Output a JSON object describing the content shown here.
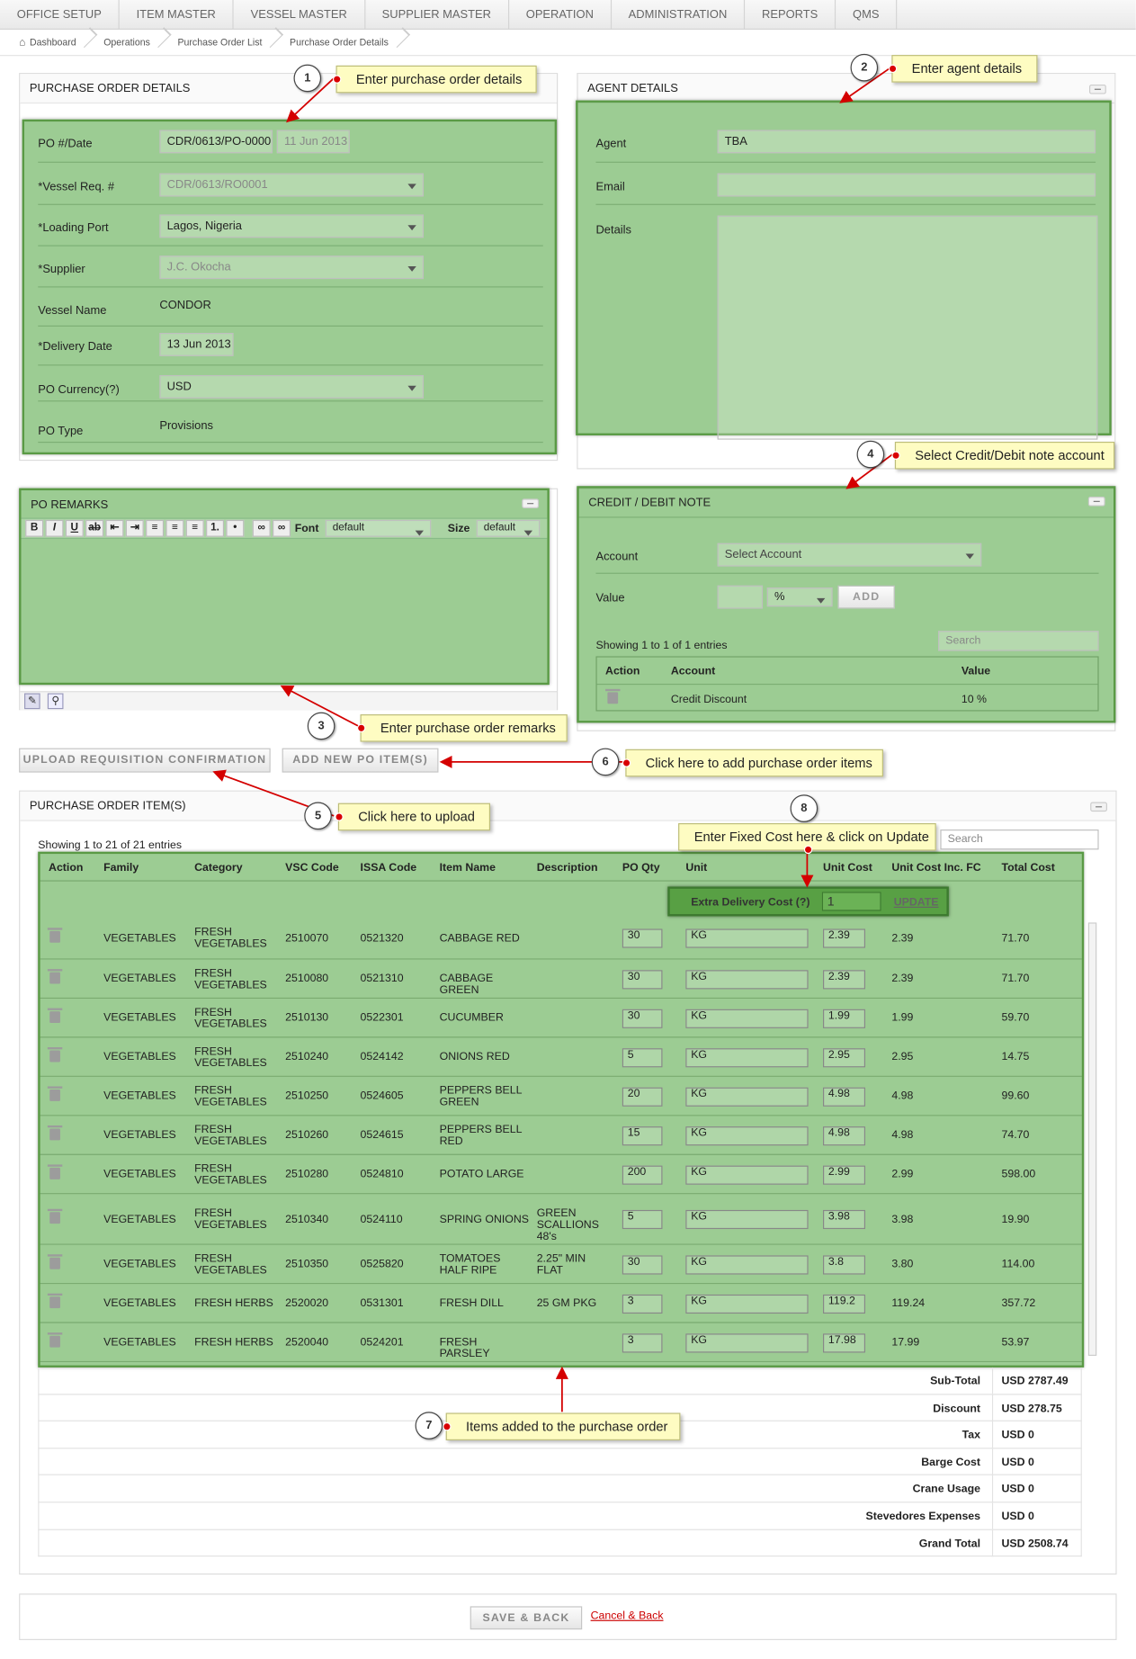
{
  "nav": [
    "OFFICE SETUP",
    "ITEM MASTER",
    "VESSEL MASTER",
    "SUPPLIER MASTER",
    "OPERATION",
    "ADMINISTRATION",
    "REPORTS",
    "QMS"
  ],
  "breadcrumb": [
    "Dashboard",
    "Operations",
    "Purchase Order List",
    "Purchase Order Details"
  ],
  "po": {
    "title": "PURCHASE ORDER DETAILS",
    "po_label": "PO #/Date",
    "po_no": "CDR/0613/PO-0000",
    "po_date": "11 Jun 2013",
    "vessel_req_label": "*Vessel Req. #",
    "vessel_req": "CDR/0613/RO0001",
    "loading_port_label": "*Loading Port",
    "loading_port": "Lagos, Nigeria",
    "supplier_label": "*Supplier",
    "supplier": "J.C. Okocha",
    "vessel_name_label": "Vessel Name",
    "vessel_name": "CONDOR",
    "delivery_label": "*Delivery Date",
    "delivery": "13 Jun 2013",
    "currency_label": "PO Currency(?)",
    "currency": "USD",
    "type_label": "PO Type",
    "type": "Provisions"
  },
  "agent": {
    "title": "AGENT DETAILS",
    "agent_label": "Agent",
    "agent": "TBA",
    "email_label": "Email",
    "details_label": "Details"
  },
  "remarks": {
    "title": "PO REMARKS",
    "font_label": "Font",
    "font_value": "default",
    "size_label": "Size",
    "size_value": "default"
  },
  "credit": {
    "title": "CREDIT / DEBIT NOTE",
    "account_label": "Account",
    "account_placeholder": "Select Account",
    "value_label": "Value",
    "unit": "%",
    "add": "ADD",
    "showing": "Showing 1 to 1 of 1 entries",
    "search": "Search",
    "col_action": "Action",
    "col_account": "Account",
    "col_value": "Value",
    "row_account": "Credit Discount",
    "row_value": "10 %"
  },
  "buttons": {
    "upload": "UPLOAD REQUISITION CONFIRMATION",
    "add_item": "ADD NEW PO ITEM(S)",
    "save": "SAVE & BACK",
    "cancel": "Cancel & Back"
  },
  "items": {
    "title": "PURCHASE ORDER ITEM(S)",
    "showing": "Showing 1 to 21 of 21 entries",
    "search": "Search",
    "headers": [
      "Action",
      "Family",
      "Category",
      "VSC Code",
      "ISSA Code",
      "Item Name",
      "Description",
      "PO Qty",
      "Unit",
      "Unit Cost",
      "Unit Cost Inc. FC",
      "Total Cost"
    ],
    "extra_label": "Extra Delivery Cost (?)",
    "extra_value": "1",
    "update": "UPDATE",
    "rows": [
      [
        "VEGETABLES",
        "FRESH VEGETABLES",
        "2510070",
        "0521320",
        "CABBAGE RED",
        "",
        "30",
        "KG",
        "2.39",
        "2.39",
        "71.70"
      ],
      [
        "VEGETABLES",
        "FRESH VEGETABLES",
        "2510080",
        "0521310",
        "CABBAGE GREEN",
        "",
        "30",
        "KG",
        "2.39",
        "2.39",
        "71.70"
      ],
      [
        "VEGETABLES",
        "FRESH VEGETABLES",
        "2510130",
        "0522301",
        "CUCUMBER",
        "",
        "30",
        "KG",
        "1.99",
        "1.99",
        "59.70"
      ],
      [
        "VEGETABLES",
        "FRESH VEGETABLES",
        "2510240",
        "0524142",
        "ONIONS RED",
        "",
        "5",
        "KG",
        "2.95",
        "2.95",
        "14.75"
      ],
      [
        "VEGETABLES",
        "FRESH VEGETABLES",
        "2510250",
        "0524605",
        "PEPPERS BELL GREEN",
        "",
        "20",
        "KG",
        "4.98",
        "4.98",
        "99.60"
      ],
      [
        "VEGETABLES",
        "FRESH VEGETABLES",
        "2510260",
        "0524615",
        "PEPPERS BELL RED",
        "",
        "15",
        "KG",
        "4.98",
        "4.98",
        "74.70"
      ],
      [
        "VEGETABLES",
        "FRESH VEGETABLES",
        "2510280",
        "0524810",
        "POTATO LARGE",
        "",
        "200",
        "KG",
        "2.99",
        "2.99",
        "598.00"
      ],
      [
        "VEGETABLES",
        "FRESH VEGETABLES",
        "2510340",
        "0524110",
        "SPRING ONIONS",
        "GREEN SCALLIONS 48's",
        "5",
        "KG",
        "3.98",
        "3.98",
        "19.90"
      ],
      [
        "VEGETABLES",
        "FRESH VEGETABLES",
        "2510350",
        "0525820",
        "TOMATOES HALF RIPE",
        "2.25\" MIN FLAT",
        "30",
        "KG",
        "3.8",
        "3.80",
        "114.00"
      ],
      [
        "VEGETABLES",
        "FRESH HERBS",
        "2520020",
        "0531301",
        "FRESH DILL",
        "25 GM PKG",
        "3",
        "KG",
        "119.2",
        "119.24",
        "357.72"
      ],
      [
        "VEGETABLES",
        "FRESH HERBS",
        "2520040",
        "0524201",
        "FRESH PARSLEY",
        "",
        "3",
        "KG",
        "17.98",
        "17.99",
        "53.97"
      ]
    ],
    "totals": [
      [
        "Sub-Total",
        "USD 2787.49"
      ],
      [
        "Discount",
        "USD 278.75"
      ],
      [
        "Tax",
        "USD 0"
      ],
      [
        "Barge Cost",
        "USD 0"
      ],
      [
        "Crane Usage",
        "USD 0"
      ],
      [
        "Stevedores Expenses",
        "USD 0"
      ],
      [
        "Grand Total",
        "USD 2508.74"
      ]
    ]
  },
  "callouts": [
    {
      "n": "1",
      "text": "Enter purchase order details"
    },
    {
      "n": "2",
      "text": "Enter agent details"
    },
    {
      "n": "3",
      "text": "Enter purchase order remarks"
    },
    {
      "n": "4",
      "text": "Select Credit/Debit note account"
    },
    {
      "n": "5",
      "text": "Click here to upload"
    },
    {
      "n": "6",
      "text": "Click here to add purchase order items"
    },
    {
      "n": "7",
      "text": "Items added to the purchase order"
    },
    {
      "n": "8",
      "text": "Enter Fixed Cost here & click on Update"
    }
  ]
}
